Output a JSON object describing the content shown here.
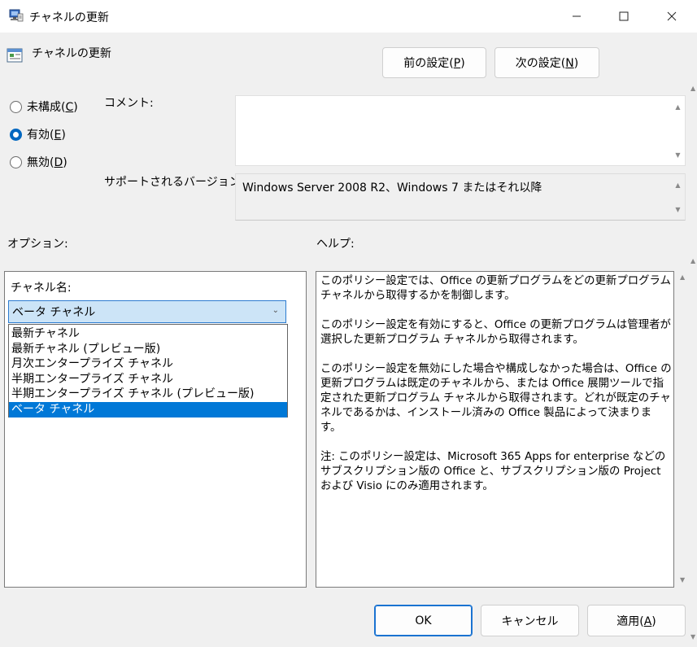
{
  "window": {
    "title": "チャネルの更新",
    "min_glyph": "—",
    "max_glyph": "☐",
    "close_glyph": "✕"
  },
  "header": {
    "title": "チャネルの更新",
    "prev_button": "前の設定(P)",
    "prev_button_text": "前の設定(",
    "prev_button_key": "P",
    "prev_button_end": ")",
    "next_button_text": "次の設定(",
    "next_button_key": "N",
    "next_button_end": ")"
  },
  "state": {
    "not_configured": {
      "text": "未構成(",
      "key": "C",
      "end": ")",
      "checked": false
    },
    "enabled": {
      "text": "有効(",
      "key": "E",
      "end": ")",
      "checked": true
    },
    "disabled": {
      "text": "無効(",
      "key": "D",
      "end": ")",
      "checked": false
    }
  },
  "comment": {
    "label": "コメント:",
    "value": ""
  },
  "supported": {
    "label": "サポートされるバージョン:",
    "value": "Windows Server 2008 R2、Windows 7 またはそれ以降"
  },
  "options": {
    "label": "オプション:",
    "channel_label": "チャネル名:",
    "selected_value": "ベータ チャネル",
    "items": [
      "最新チャネル",
      "最新チャネル (プレビュー版)",
      "月次エンタープライズ チャネル",
      "半期エンタープライズ チャネル",
      "半期エンタープライズ チャネル (プレビュー版)",
      "ベータ チャネル"
    ],
    "selected_index": 5
  },
  "help": {
    "label": "ヘルプ:",
    "paragraphs": [
      "このポリシー設定では、Office の更新プログラムをどの更新プログラム チャネルから取得するかを制御します。",
      "このポリシー設定を有効にすると、Office の更新プログラムは管理者が選択した更新プログラム チャネルから取得されます。",
      "このポリシー設定を無効にした場合や構成しなかった場合は、Office の更新プログラムは既定のチャネルから、または Office 展開ツールで指定された更新プログラム チャネルから取得されます。どれが既定のチャネルであるかは、インストール済みの Office 製品によって決まります。",
      "注: このポリシー設定は、Microsoft 365 Apps for enterprise などのサブスクリプション版の Office と、サブスクリプション版の Project および Visio にのみ適用されます。"
    ]
  },
  "footer": {
    "ok": "OK",
    "cancel": "キャンセル",
    "apply_text": "適用(",
    "apply_key": "A",
    "apply_end": ")"
  },
  "colors": {
    "accent": "#0067c0",
    "selection": "#0078d7",
    "combo_bg": "#cce4f7"
  }
}
